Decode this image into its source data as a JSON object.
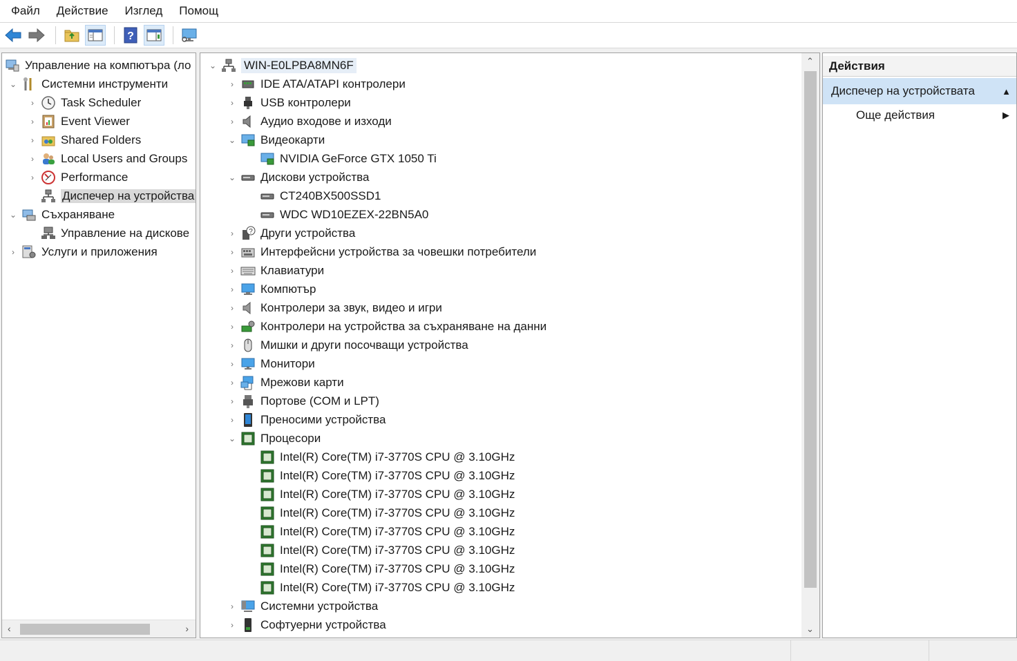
{
  "menu": [
    "Файл",
    "Действие",
    "Изглед",
    "Помощ"
  ],
  "toolbar": [
    "back-arrow-icon",
    "forward-arrow-icon",
    "up-folder-icon",
    "show-hide-tree-icon",
    "help-icon",
    "properties-icon",
    "monitor-icon"
  ],
  "left_tree": {
    "root": "Управление на компютъра (ло",
    "system_tools": "Системни инструменти",
    "task_scheduler": "Task Scheduler",
    "event_viewer": "Event Viewer",
    "shared_folders": "Shared Folders",
    "local_users": "Local Users and Groups",
    "performance": "Performance",
    "device_manager": "Диспечер на устройства",
    "storage": "Съхраняване",
    "disk_management": "Управление на дискове",
    "services": "Услуги и приложения"
  },
  "center_tree": {
    "root": "WIN-E0LPBA8MN6F",
    "categories": [
      {
        "label": "IDE ATA/ATAPI контролери",
        "icon": "ide-controller-icon"
      },
      {
        "label": "USB контролери",
        "icon": "usb-icon"
      },
      {
        "label": "Аудио входове и изходи",
        "icon": "speaker-icon"
      },
      {
        "label": "Видеокарти",
        "icon": "display-adapter-icon",
        "expanded": true
      },
      {
        "label": "NVIDIA GeForce GTX 1050 Ti",
        "icon": "display-adapter-icon",
        "child": true
      },
      {
        "label": "Дискови устройства",
        "icon": "disk-drive-icon",
        "expanded": true
      },
      {
        "label": "CT240BX500SSD1",
        "icon": "disk-drive-icon",
        "child": true
      },
      {
        "label": "WDC WD10EZEX-22BN5A0",
        "icon": "disk-drive-icon",
        "child": true
      },
      {
        "label": "Други устройства",
        "icon": "unknown-device-icon"
      },
      {
        "label": "Интерфейсни устройства за човешки потребители",
        "icon": "hid-icon"
      },
      {
        "label": "Клавиатури",
        "icon": "keyboard-icon"
      },
      {
        "label": "Компютър",
        "icon": "computer-icon"
      },
      {
        "label": "Контролери за звук, видео и игри",
        "icon": "sound-icon"
      },
      {
        "label": "Контролери на устройства за съхраняване на данни",
        "icon": "storage-controller-icon"
      },
      {
        "label": "Мишки и други посочващи устройства",
        "icon": "mouse-icon"
      },
      {
        "label": "Монитори",
        "icon": "monitor-icon"
      },
      {
        "label": "Мрежови карти",
        "icon": "network-adapter-icon"
      },
      {
        "label": "Портове (COM и LPT)",
        "icon": "port-icon"
      },
      {
        "label": "Преносими устройства",
        "icon": "portable-device-icon"
      },
      {
        "label": "Процесори",
        "icon": "processor-icon",
        "expanded": true
      },
      {
        "label": "Intel(R) Core(TM) i7-3770S CPU @ 3.10GHz",
        "icon": "processor-icon",
        "child": true
      },
      {
        "label": "Intel(R) Core(TM) i7-3770S CPU @ 3.10GHz",
        "icon": "processor-icon",
        "child": true
      },
      {
        "label": "Intel(R) Core(TM) i7-3770S CPU @ 3.10GHz",
        "icon": "processor-icon",
        "child": true
      },
      {
        "label": "Intel(R) Core(TM) i7-3770S CPU @ 3.10GHz",
        "icon": "processor-icon",
        "child": true
      },
      {
        "label": "Intel(R) Core(TM) i7-3770S CPU @ 3.10GHz",
        "icon": "processor-icon",
        "child": true
      },
      {
        "label": "Intel(R) Core(TM) i7-3770S CPU @ 3.10GHz",
        "icon": "processor-icon",
        "child": true
      },
      {
        "label": "Intel(R) Core(TM) i7-3770S CPU @ 3.10GHz",
        "icon": "processor-icon",
        "child": true
      },
      {
        "label": "Intel(R) Core(TM) i7-3770S CPU @ 3.10GHz",
        "icon": "processor-icon",
        "child": true
      },
      {
        "label": "Системни устройства",
        "icon": "system-device-icon"
      },
      {
        "label": "Софтуерни устройства",
        "icon": "software-device-icon"
      }
    ]
  },
  "actions": {
    "header": "Действия",
    "section": "Диспечер на устройствата",
    "more": "Още действия"
  },
  "colors": {
    "selection_bg": "#cfe3f6",
    "tree_bg": "#ffffff",
    "chrome_bg": "#f0f0f0"
  }
}
